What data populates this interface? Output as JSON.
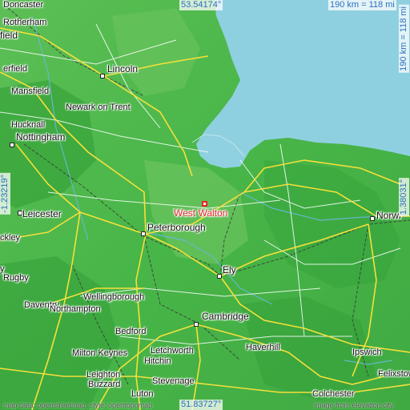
{
  "map": {
    "target": {
      "name": "West Walton"
    },
    "coords": {
      "north": "53.54174°",
      "south": "51.83727°",
      "west": "-1.23219°",
      "east": "1.38031°"
    },
    "scale": {
      "top": "190 km = 118 mi",
      "right": "190 km = 118 mi"
    },
    "attribution": {
      "left": "map data: openstreetmap, style: opentopomap",
      "right": "image from elevation.city"
    },
    "places": [
      {
        "id": "doncaster",
        "name": "Doncaster"
      },
      {
        "id": "rotherham",
        "name": "Rotherham"
      },
      {
        "id": "sheffield",
        "name": "field"
      },
      {
        "id": "chesterfield",
        "name": "erfield"
      },
      {
        "id": "mansfield",
        "name": "Mansfield"
      },
      {
        "id": "lincoln",
        "name": "Lincoln"
      },
      {
        "id": "newark",
        "name": "Newark on Trent"
      },
      {
        "id": "hucknall",
        "name": "Hucknall"
      },
      {
        "id": "nottingham",
        "name": "Nottingham"
      },
      {
        "id": "leicester",
        "name": "Leicester"
      },
      {
        "id": "hinckley",
        "name": "ckley"
      },
      {
        "id": "rugby",
        "name": "Rugby"
      },
      {
        "id": "daventry",
        "name": "Daventry"
      },
      {
        "id": "northampton",
        "name": "Northampton"
      },
      {
        "id": "wellingborough",
        "name": "Wellingborough"
      },
      {
        "id": "peterborough",
        "name": "Peterborough"
      },
      {
        "id": "ely",
        "name": "Ely"
      },
      {
        "id": "cambridge",
        "name": "Cambridge"
      },
      {
        "id": "bedford",
        "name": "Bedford"
      },
      {
        "id": "milton_keynes",
        "name": "Milton Keynes"
      },
      {
        "id": "hitchin",
        "name": "Hitchin"
      },
      {
        "id": "letchworth",
        "name": "Letchworth"
      },
      {
        "id": "stevenage",
        "name": "Stevenage"
      },
      {
        "id": "leighton",
        "name": "Leighton"
      },
      {
        "id": "buzzard",
        "name": "Buzzard"
      },
      {
        "id": "luton",
        "name": "Luton"
      },
      {
        "id": "haverhill",
        "name": "Haverhill"
      },
      {
        "id": "ipswich",
        "name": "Ipswich"
      },
      {
        "id": "felixstowe",
        "name": "Felixstow"
      },
      {
        "id": "colchester",
        "name": "Colchester"
      },
      {
        "id": "norwich",
        "name": "Norwi"
      },
      {
        "id": "coventry_fragment",
        "name": "y"
      }
    ]
  },
  "colors": {
    "sea": "#8fd0e0",
    "land": "#4db84a",
    "land_dark": "#2e9a35",
    "land_light": "#7fcc6a",
    "road_primary": "#f6e03a",
    "road_secondary": "#ffffff",
    "rail": "#333333",
    "target": "#e8262c",
    "coord_text": "#2e6fbf"
  }
}
